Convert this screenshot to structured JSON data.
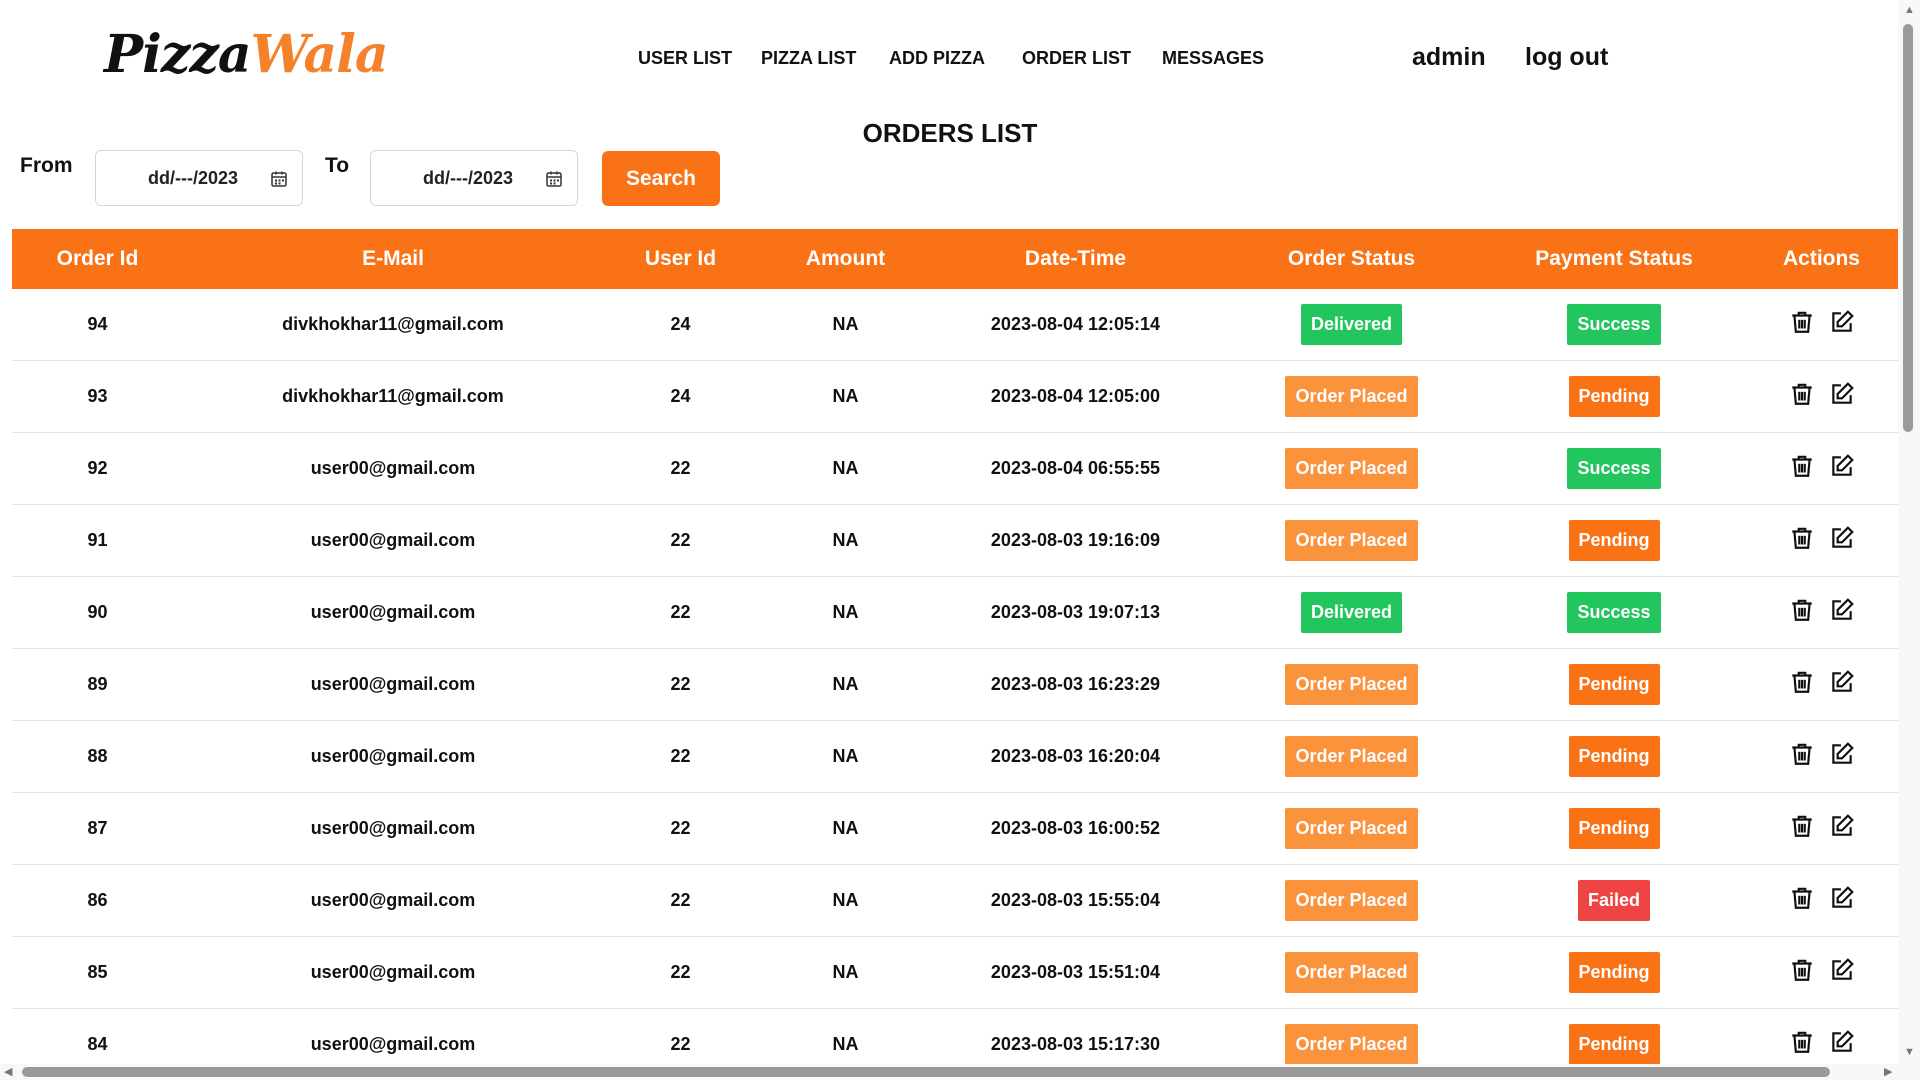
{
  "logo": {
    "part1": "Pizza",
    "part2": "Wala"
  },
  "nav": [
    "USER LIST",
    "PIZZA LIST",
    "ADD PIZZA",
    "ORDER LIST",
    "MESSAGES"
  ],
  "user": {
    "name": "admin",
    "logout": "log out"
  },
  "page_title": "ORDERS LIST",
  "filter": {
    "from_label": "From",
    "from_value": "dd/---/2023",
    "to_label": "To",
    "to_value": "dd/---/2023",
    "search_label": "Search"
  },
  "table": {
    "headers": [
      "Order Id",
      "E-Mail",
      "User Id",
      "Amount",
      "Date-Time",
      "Order Status",
      "Payment Status",
      "Actions"
    ],
    "rows": [
      {
        "id": "94",
        "email": "divkhokhar11@gmail.com",
        "user": "24",
        "amount": "NA",
        "datetime": "2023-08-04 12:05:14",
        "order": "Delivered",
        "payment": "Success"
      },
      {
        "id": "93",
        "email": "divkhokhar11@gmail.com",
        "user": "24",
        "amount": "NA",
        "datetime": "2023-08-04 12:05:00",
        "order": "Order Placed",
        "payment": "Pending"
      },
      {
        "id": "92",
        "email": "user00@gmail.com",
        "user": "22",
        "amount": "NA",
        "datetime": "2023-08-04 06:55:55",
        "order": "Order Placed",
        "payment": "Success"
      },
      {
        "id": "91",
        "email": "user00@gmail.com",
        "user": "22",
        "amount": "NA",
        "datetime": "2023-08-03 19:16:09",
        "order": "Order Placed",
        "payment": "Pending"
      },
      {
        "id": "90",
        "email": "user00@gmail.com",
        "user": "22",
        "amount": "NA",
        "datetime": "2023-08-03 19:07:13",
        "order": "Delivered",
        "payment": "Success"
      },
      {
        "id": "89",
        "email": "user00@gmail.com",
        "user": "22",
        "amount": "NA",
        "datetime": "2023-08-03 16:23:29",
        "order": "Order Placed",
        "payment": "Pending"
      },
      {
        "id": "88",
        "email": "user00@gmail.com",
        "user": "22",
        "amount": "NA",
        "datetime": "2023-08-03 16:20:04",
        "order": "Order Placed",
        "payment": "Pending"
      },
      {
        "id": "87",
        "email": "user00@gmail.com",
        "user": "22",
        "amount": "NA",
        "datetime": "2023-08-03 16:00:52",
        "order": "Order Placed",
        "payment": "Pending"
      },
      {
        "id": "86",
        "email": "user00@gmail.com",
        "user": "22",
        "amount": "NA",
        "datetime": "2023-08-03 15:55:04",
        "order": "Order Placed",
        "payment": "Failed"
      },
      {
        "id": "85",
        "email": "user00@gmail.com",
        "user": "22",
        "amount": "NA",
        "datetime": "2023-08-03 15:51:04",
        "order": "Order Placed",
        "payment": "Pending"
      },
      {
        "id": "84",
        "email": "user00@gmail.com",
        "user": "22",
        "amount": "NA",
        "datetime": "2023-08-03 15:17:30",
        "order": "Order Placed",
        "payment": "Pending"
      }
    ],
    "actions": [
      "trash-icon",
      "edit-icon"
    ]
  },
  "colors": {
    "accent": "#f97316",
    "logo_accent": "#f5812b",
    "delivered": "#22c55e",
    "order_placed": "#fb923c",
    "success": "#22c55e",
    "pending": "#f97316",
    "failed": "#ef4444"
  }
}
